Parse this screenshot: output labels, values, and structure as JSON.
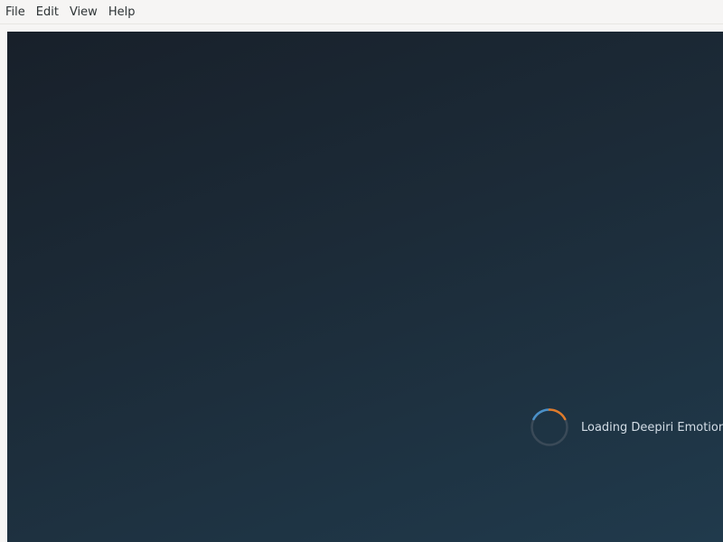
{
  "menubar": {
    "items": [
      {
        "label": "File"
      },
      {
        "label": "Edit"
      },
      {
        "label": "View"
      },
      {
        "label": "Help"
      }
    ]
  },
  "loader": {
    "text": "Loading Deepiri Emotion…",
    "icon": "spinner-icon",
    "colors": {
      "track": "#3a4a58",
      "arc_blue": "#4a90c8",
      "arc_orange": "#e07b2a"
    }
  },
  "surface": {
    "background_start": "#18202a",
    "background_end": "#203a4c"
  }
}
